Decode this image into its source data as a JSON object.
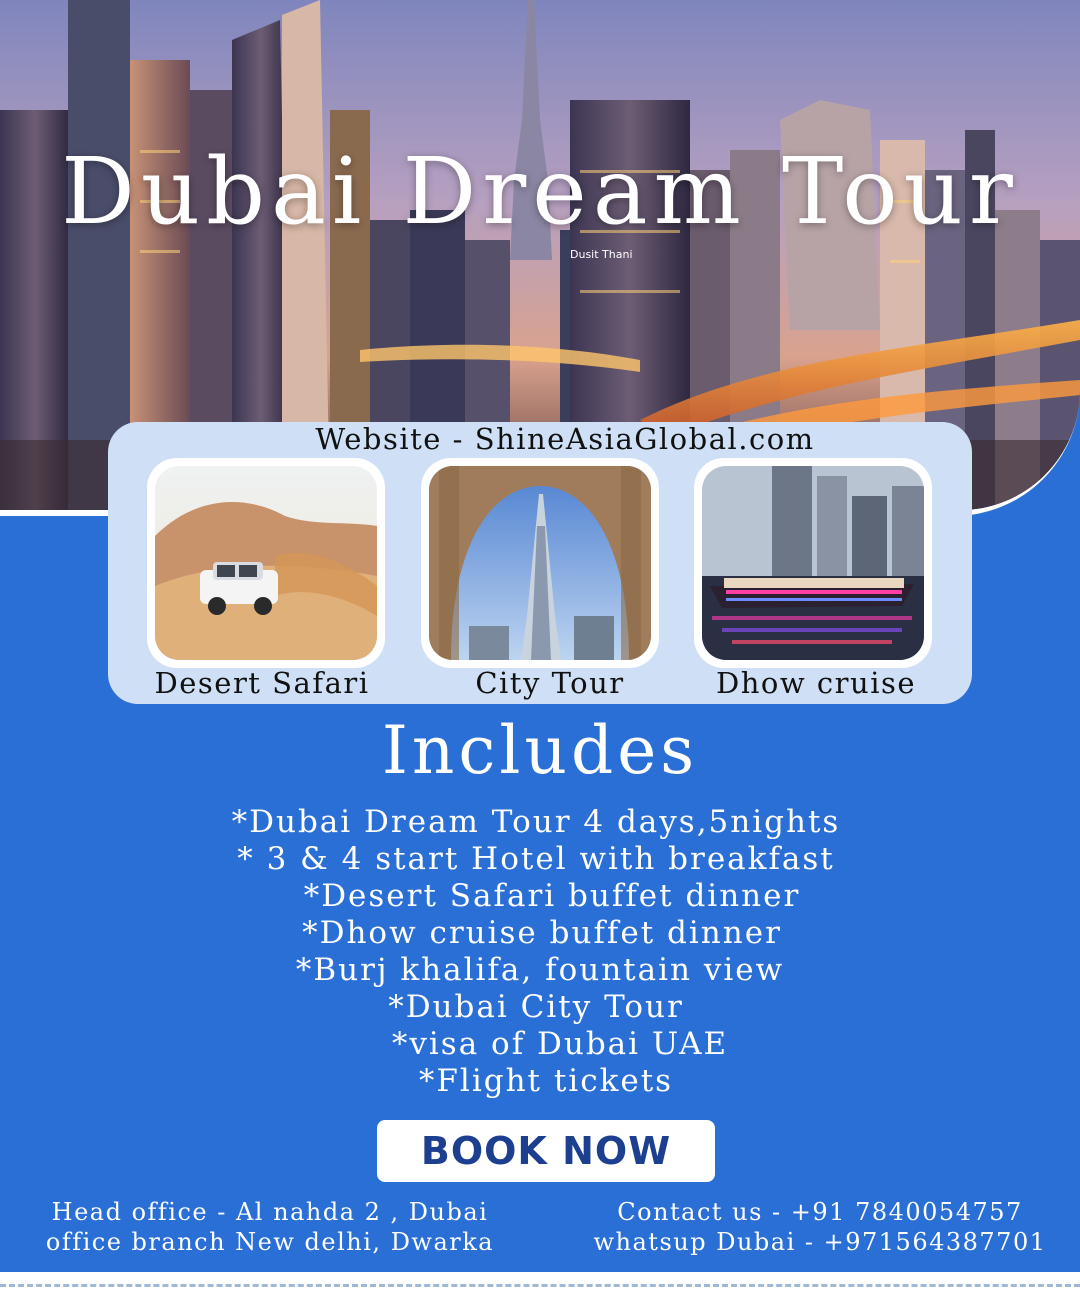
{
  "hero": {
    "title": "Dubai Dream Tour",
    "building_sign": "Dusit Thani"
  },
  "website": "Website - ShineAsiaGlobal.com",
  "activities": [
    {
      "label": "Desert Safari",
      "icon": "desert-suv-photo"
    },
    {
      "label": "City Tour",
      "icon": "burj-khalifa-photo"
    },
    {
      "label": "Dhow cruise",
      "icon": "dhow-cruise-photo"
    }
  ],
  "includes": {
    "title": "Includes",
    "items": [
      "*Dubai Dream Tour 4 days,5nights",
      "* 3 & 4 start Hotel with breakfast",
      "*Desert Safari buffet dinner",
      "*Dhow cruise buffet dinner",
      "*Burj khalifa, fountain view",
      "*Dubai City Tour",
      "*visa of Dubai UAE",
      "*Flight tickets"
    ]
  },
  "cta": {
    "label": "BOOK NOW"
  },
  "footer": {
    "head_office": "Head office - Al nahda 2 , Dubai",
    "branch": "office branch New delhi, Dwarka",
    "contact": "Contact us - +91 7840054757",
    "whatsapp": "whatsup Dubai - +971564387701"
  },
  "colors": {
    "background": "#2a6fd6",
    "panel": "#cfe0f6",
    "button_text": "#1d3f8f"
  }
}
